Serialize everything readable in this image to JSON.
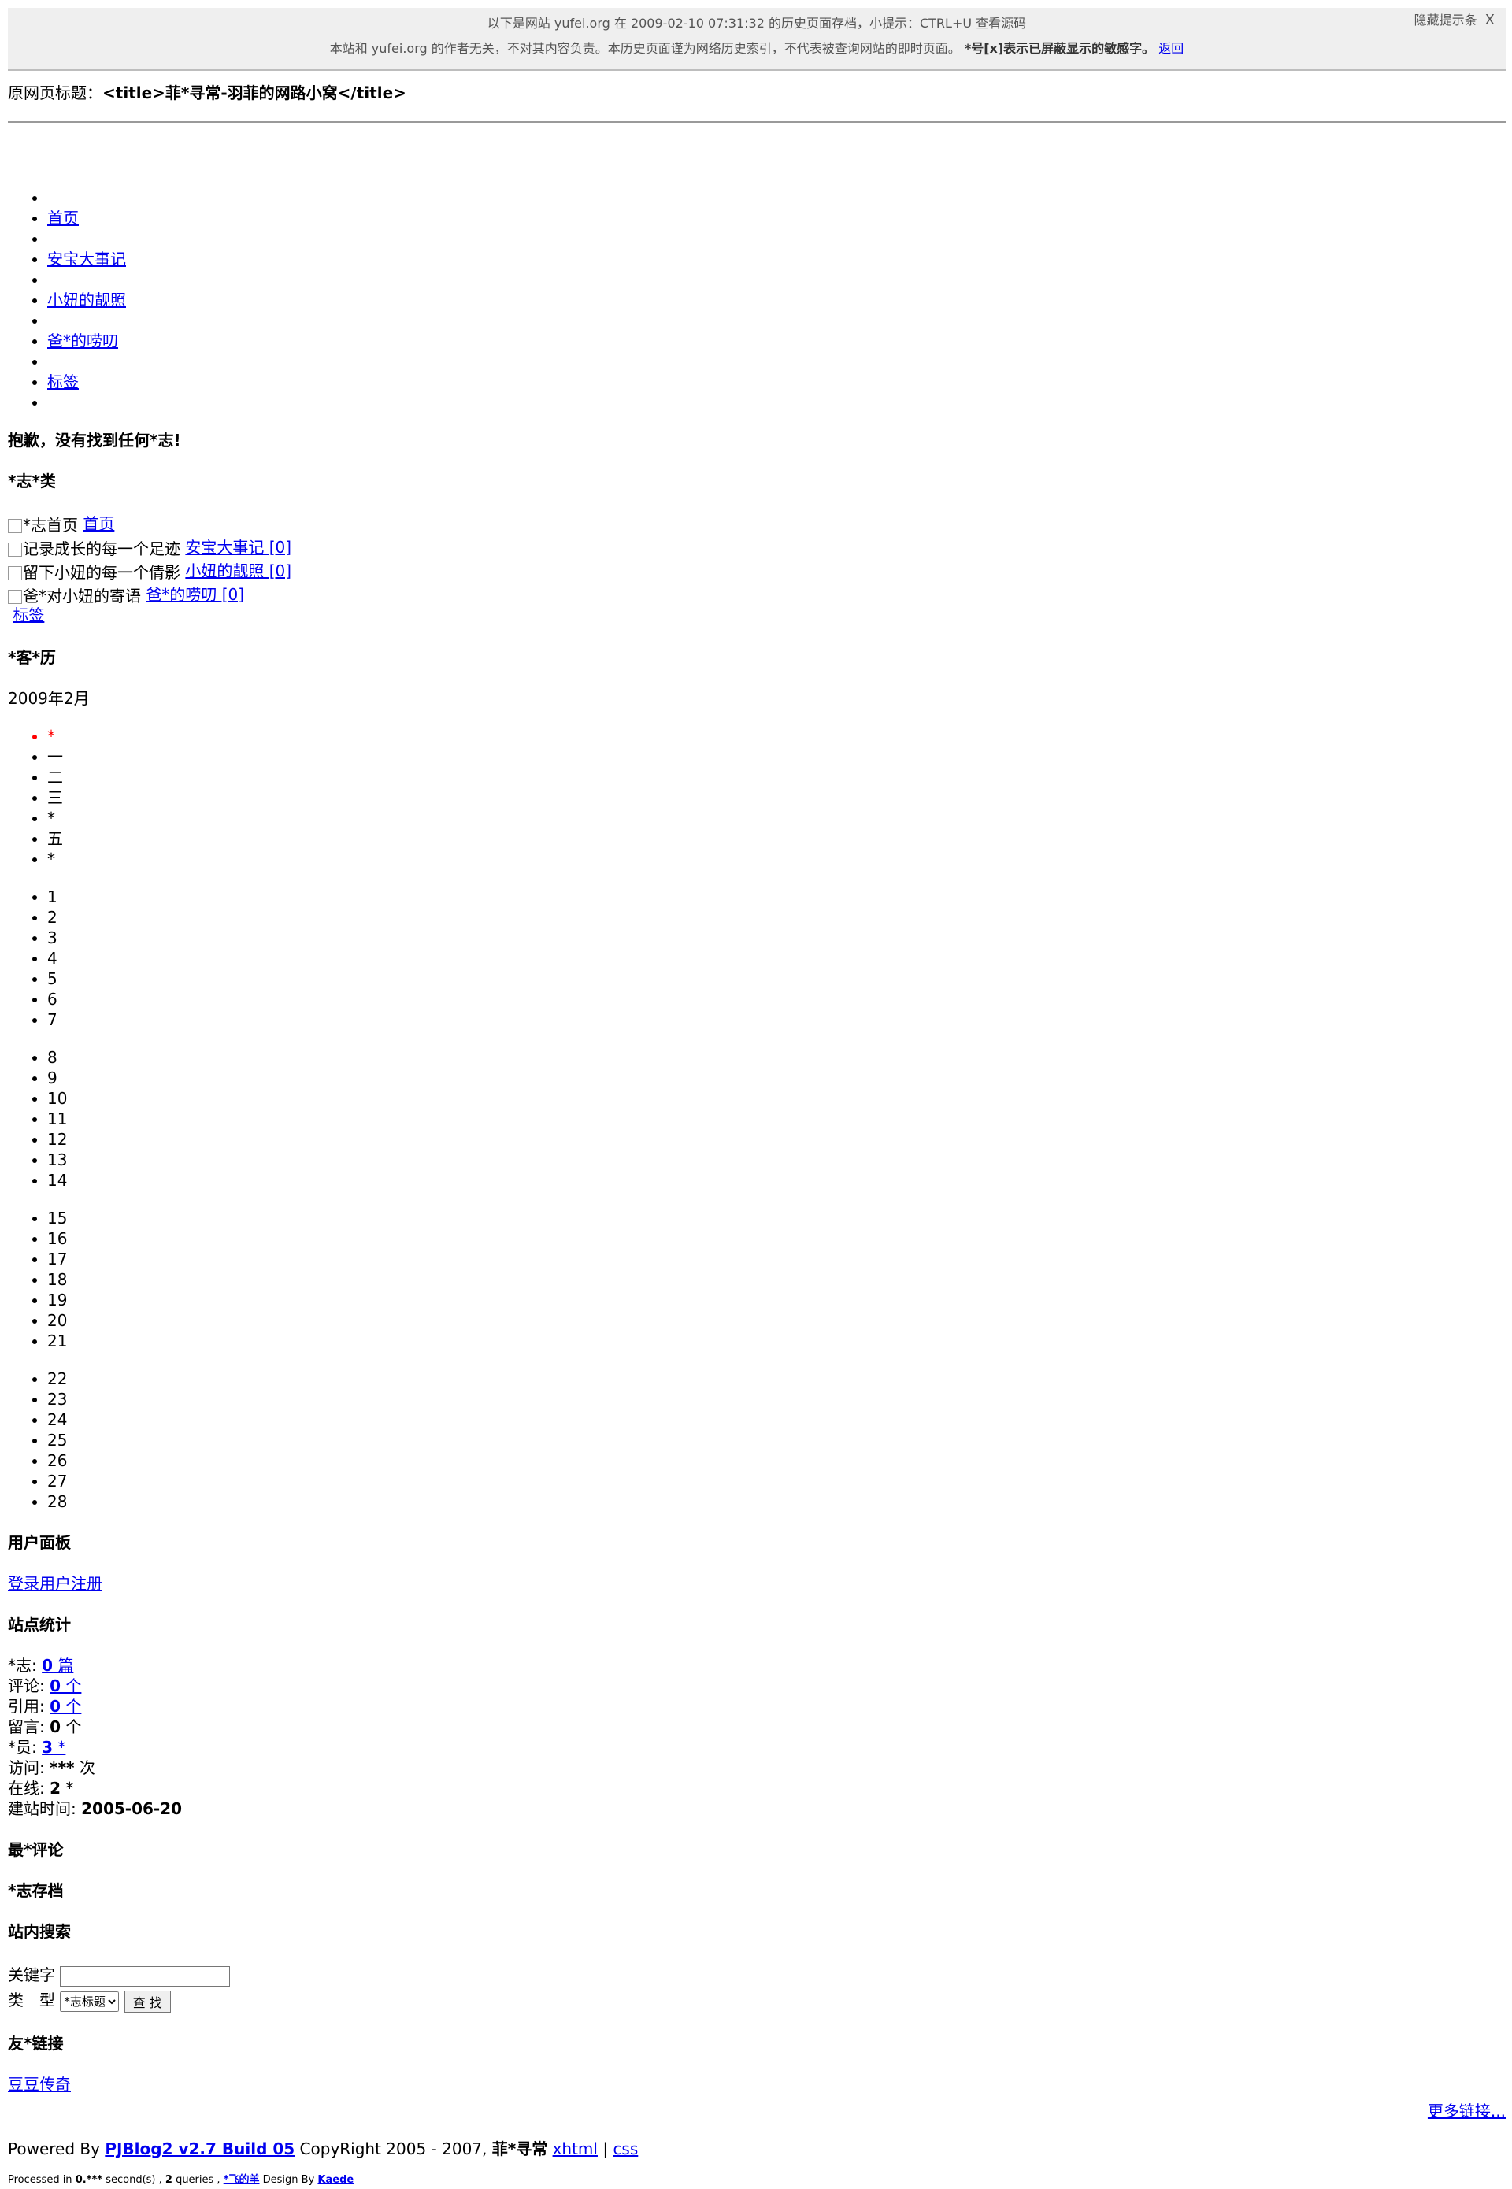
{
  "notice": {
    "line1": "以下是网站 yufei.org 在 2009-02-10 07:31:32 的历史页面存档，小提示：CTRL+U 查看源码",
    "line2": "本站和 yufei.org 的作者无关，不对其内容负责。本历史页面谨为网络历史索引，不代表被查询网站的即时页面。",
    "line2_bold": "*号[x]表示已屏蔽显示的敏感字。",
    "back_link": "返回",
    "hide_label": "隐藏提示条",
    "hide_x": "X"
  },
  "original_title": {
    "label": "原网页标题：",
    "value": "<title>菲*寻常-羽菲的网路小窝</title>"
  },
  "nav": {
    "items": [
      "首页",
      "安宝大事记",
      "小妞的靓照",
      "爸*的唠叨",
      "标签"
    ]
  },
  "not_found": "抱歉，没有找到任何*志!",
  "categories": {
    "heading": "*志*类",
    "items": [
      {
        "alt": "*志首页",
        "label": "首页"
      },
      {
        "alt": "记录成长的每一个足迹",
        "label": "安宝大事记 [0]"
      },
      {
        "alt": "留下小妞的每一个倩影",
        "label": "小妞的靓照 [0]"
      },
      {
        "alt": "爸*对小妞的寄语",
        "label": "爸*的唠叨 [0]"
      }
    ],
    "tags": "标签"
  },
  "calendar": {
    "heading": "*客*历",
    "month": "2009年2月",
    "weekdays": [
      "*",
      "一",
      "二",
      "三",
      "*",
      "五",
      "*"
    ],
    "weeks": [
      [
        "1",
        "2",
        "3",
        "4",
        "5",
        "6",
        "7"
      ],
      [
        "8",
        "9",
        "10",
        "11",
        "12",
        "13",
        "14"
      ],
      [
        "15",
        "16",
        "17",
        "18",
        "19",
        "20",
        "21"
      ],
      [
        "22",
        "23",
        "24",
        "25",
        "26",
        "27",
        "28"
      ]
    ]
  },
  "user_panel": {
    "heading": "用户面板",
    "login": "登录",
    "register": "用户注册"
  },
  "stats": {
    "heading": "站点统计",
    "rows": {
      "log_label": "*志: ",
      "log_num": "0",
      "log_unit": " 篇",
      "comment_label": "评论: ",
      "comment_num": "0",
      "comment_unit": " 个",
      "ref_label": "引用: ",
      "ref_num": "0",
      "ref_unit": " 个",
      "msg_label": "留言: ",
      "msg_num": "0",
      "msg_unit": " 个",
      "member_label": "*员: ",
      "member_num": "3",
      "member_unit": " *",
      "visit_label": "访问: ",
      "visit_num": "***",
      "visit_unit": " 次",
      "online_label": "在线: ",
      "online_num": "2",
      "online_unit": " *",
      "since_label": "建站时间: ",
      "since_value": "2005-06-20"
    }
  },
  "recent_comments": "最*评论",
  "archive": "*志存档",
  "search": {
    "heading": "站内搜索",
    "keyword_label": "关键字",
    "type_label": "类　型",
    "type_selected": "*志标题",
    "button": "查 找"
  },
  "links": {
    "heading": "友*链接",
    "items": [
      "豆豆传奇"
    ],
    "more": "更多链接..."
  },
  "footer": {
    "powered_by": "Powered By ",
    "pjblog": "PJBlog2 v2.7 Build 05",
    "copyright": " CopyRight 2005 - 2007, ",
    "site_name": "菲*寻常",
    "xhtml": "xhtml",
    "pipe": " | ",
    "css": "css",
    "processed_prefix": "Processed in ",
    "processed_time": "0.***",
    "processed_mid": " second(s) , ",
    "queries": "2",
    "queries_suffix": " queries , ",
    "designer_link": "*飞的羊",
    "design_by": " Design By ",
    "kaede": "Kaede"
  }
}
